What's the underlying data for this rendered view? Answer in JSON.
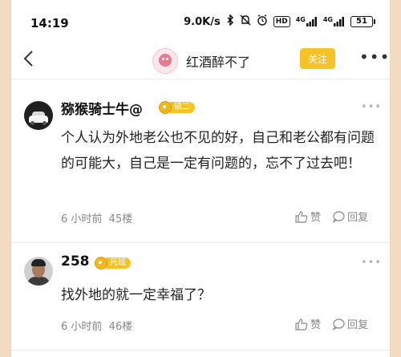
{
  "status_bar": {
    "time": "14:19",
    "network_speed": "9.0K/s",
    "signal_label_1": "4G",
    "signal_label_2": "4G",
    "hd_label": "HD",
    "battery": "51",
    "icons": [
      "bluetooth-icon",
      "mute-icon",
      "alarm-icon",
      "hd-icon",
      "signal-icon",
      "signal-icon",
      "battery-icon"
    ]
  },
  "header": {
    "title": "红酒醉不了",
    "follow_label": "关注",
    "more_label": "•••",
    "colors": {
      "follow_bg": "#f6c327"
    }
  },
  "comments": [
    {
      "username": "猕猴骑士牛@",
      "badge_level": "硕二",
      "text": "个人认为外地老公也不见的好，自己和老公都有问题的可能大，自己是一定有问题的，忘不了过去吧！",
      "time": "6 小时前",
      "floor": "45楼",
      "like_label": "赞",
      "reply_label": "回复",
      "more_label": "•••"
    },
    {
      "username": "258",
      "badge_level": "托班",
      "text": "找外地的就一定幸福了？",
      "time": "6 小时前",
      "floor": "46楼",
      "like_label": "赞",
      "reply_label": "回复",
      "more_label": "•••"
    }
  ]
}
